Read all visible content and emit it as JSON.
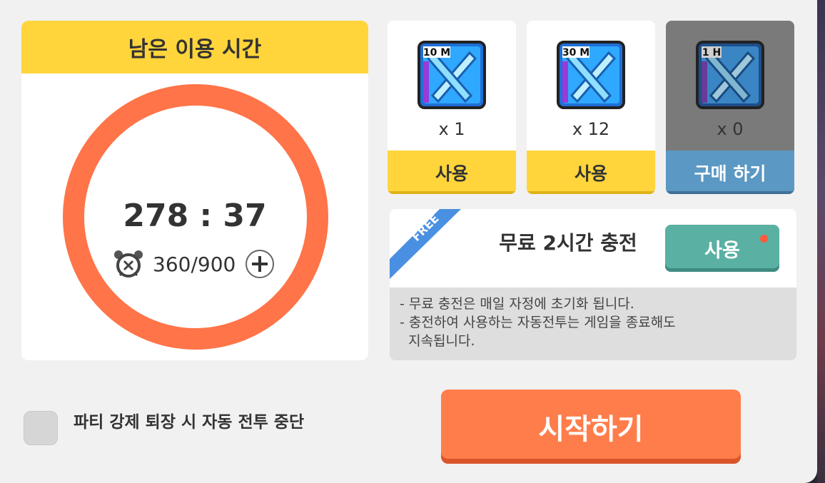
{
  "timer": {
    "title": "남은 이용 시간",
    "remaining": "278 : 37",
    "stamina": "360/900",
    "ring_color": "#ff7448"
  },
  "items": [
    {
      "badge": "10 M",
      "count": "x 1",
      "button": "사용",
      "style": "yellow"
    },
    {
      "badge": "30 M",
      "count": "x 12",
      "button": "사용",
      "style": "yellow"
    },
    {
      "badge": "1 H",
      "count": "x 0",
      "button": "구매 하기",
      "style": "blue"
    }
  ],
  "free": {
    "ribbon": "FREE",
    "title": "무료 2시간 충전",
    "button": "사용",
    "notes": [
      "- 무료 충전은 매일 자정에 초기화 됩니다.",
      "- 충전하여 사용하는 자동전투는 게임을 종료해도",
      "  지속됩니다."
    ]
  },
  "option": {
    "label": "파티 강제 퇴장 시 자동 전투 중단",
    "checked": false
  },
  "start_button": "시작하기",
  "colors": {
    "yellow": "#ffd53b",
    "orange": "#ff7d4b",
    "teal": "#5ab0a3",
    "blue": "#5b98c3"
  }
}
